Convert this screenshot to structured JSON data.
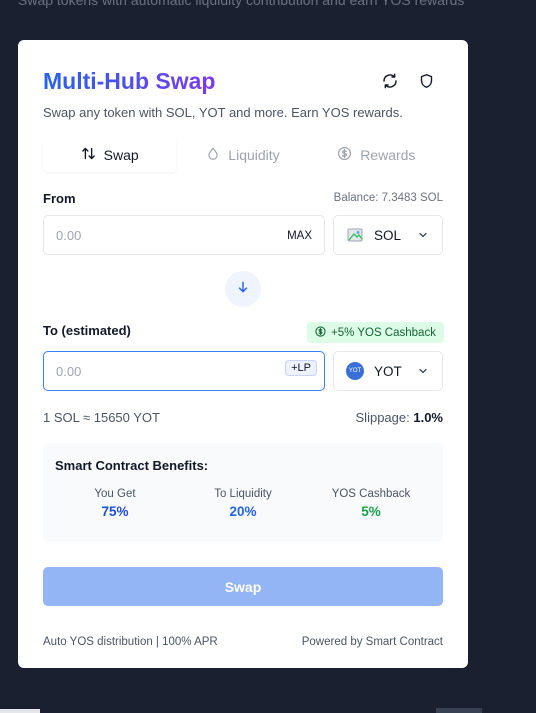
{
  "background": {
    "partial_text": "Swap tokens with automatic liquidity contribution and earn YOS rewards"
  },
  "header": {
    "title": "Multi-Hub Swap",
    "subtitle": "Swap any token with SOL, YOT and more. Earn YOS rewards."
  },
  "tabs": [
    {
      "label": "Swap",
      "icon": "swap-vertical-icon",
      "active": true
    },
    {
      "label": "Liquidity",
      "icon": "droplet-icon",
      "active": false
    },
    {
      "label": "Rewards",
      "icon": "dollar-circle-icon",
      "active": false
    }
  ],
  "from": {
    "label": "From",
    "balance": "Balance: 7.3483 SOL",
    "placeholder": "0.00",
    "max_label": "MAX",
    "token": "SOL"
  },
  "to": {
    "label": "To (estimated)",
    "cashback_badge": "+5% YOS Cashback",
    "placeholder": "0.00",
    "lp_badge": "+LP",
    "token": "YOT",
    "token_icon_text": "YOT"
  },
  "rate": {
    "text": "1 SOL ≈ 15650 YOT",
    "slippage_label": "Slippage:",
    "slippage_value": "1.0%"
  },
  "benefits": {
    "title": "Smart Contract Benefits:",
    "items": [
      {
        "label": "You Get",
        "value": "75%"
      },
      {
        "label": "To Liquidity",
        "value": "20%"
      },
      {
        "label": "YOS Cashback",
        "value": "5%"
      }
    ]
  },
  "swap_button": "Swap",
  "footer": {
    "left": "Auto YOS distribution | 100% APR",
    "right": "Powered by Smart Contract"
  },
  "colors": {
    "background": "#1a2030",
    "accent": "#3b82f6",
    "swap_button": "#93b4f5",
    "you_get": "#1d4ed8",
    "to_liquidity": "#2563eb",
    "yos_cashback": "#16a34a"
  }
}
